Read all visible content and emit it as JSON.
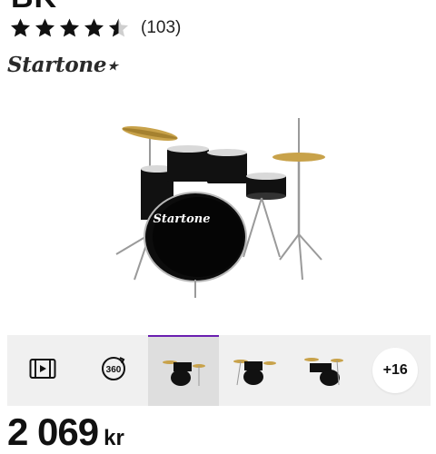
{
  "product": {
    "title_fragment": "BK",
    "rating_value": 4.5,
    "review_count": "(103)",
    "brand": "Startone",
    "brand_mark": "★"
  },
  "gallery": {
    "hero_drum_logo": "Startone",
    "thumbnails": [
      {
        "type": "video",
        "icon": "video-icon"
      },
      {
        "type": "360",
        "icon": "rotate-360-icon",
        "label": "360"
      },
      {
        "type": "image",
        "active": true
      },
      {
        "type": "image"
      },
      {
        "type": "image"
      }
    ],
    "more_label": "+16",
    "accent_color": "#6a1fb0"
  },
  "price": {
    "amount": "2 069",
    "currency": "kr"
  }
}
